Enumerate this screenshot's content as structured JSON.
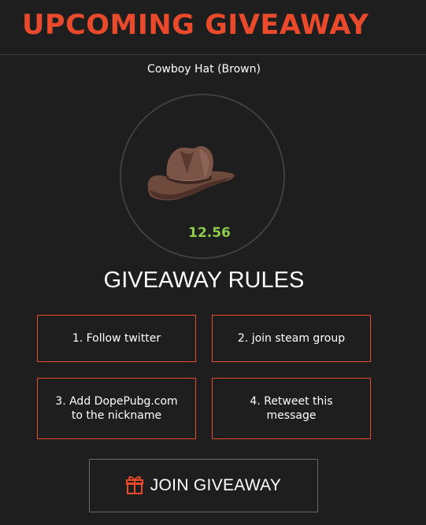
{
  "header": {
    "title": "UPCOMING GIVEAWAY"
  },
  "item": {
    "name": "Cowboy Hat (Brown)",
    "price": "12.56",
    "icon": "cowboy-hat-icon"
  },
  "rules": {
    "title": "GIVEAWAY RULES",
    "items": [
      {
        "label": "1. Follow twitter"
      },
      {
        "label": "2. join steam group"
      },
      {
        "label": "3. Add DopePubg.com to the nickname"
      },
      {
        "label": "4. Retweet this message"
      }
    ]
  },
  "join": {
    "label": "JOIN GIVEAWAY",
    "icon": "gift-icon"
  },
  "colors": {
    "background": "#1e1e1e",
    "accent": "#e84a2b",
    "price": "#8fcc4a",
    "text": "#ffffff"
  }
}
